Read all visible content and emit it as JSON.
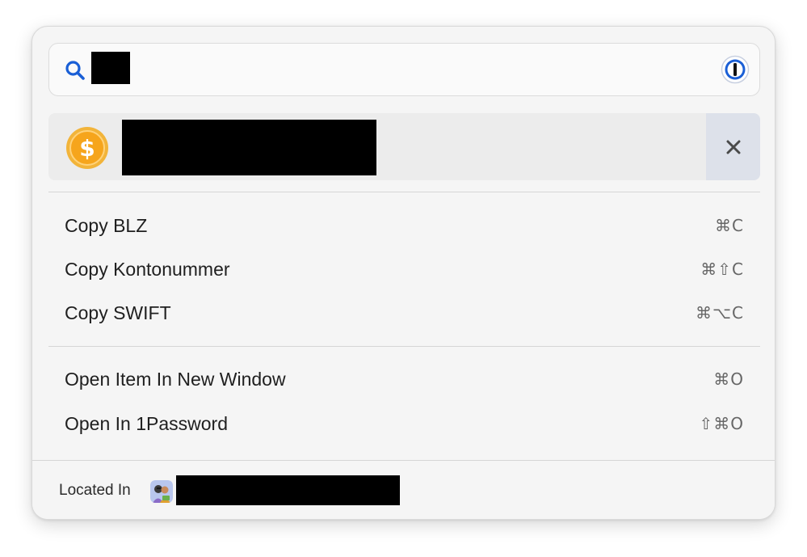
{
  "search": {
    "query_redacted": true,
    "icon": "search-icon",
    "app_icon": "1password-icon"
  },
  "item": {
    "icon": "coin-icon",
    "title_redacted": true,
    "close_icon": "close-icon"
  },
  "actions_group1": [
    {
      "label": "Copy BLZ",
      "shortcut": "⌘C"
    },
    {
      "label": "Copy Kontonummer",
      "shortcut": "⌘⇧C"
    },
    {
      "label": "Copy SWIFT",
      "shortcut": "⌘⌥C"
    }
  ],
  "actions_group2": [
    {
      "label": "Open Item In New Window",
      "shortcut": "⌘O"
    },
    {
      "label": "Open In 1Password",
      "shortcut": "⇧⌘O"
    }
  ],
  "footer": {
    "label": "Located In",
    "vault_icon": "vault-avatar-icon",
    "vault_name_redacted": true
  },
  "colors": {
    "accent_blue": "#1a5fd6",
    "coin_gold": "#f5a623",
    "close_bg": "#dde1ea"
  }
}
